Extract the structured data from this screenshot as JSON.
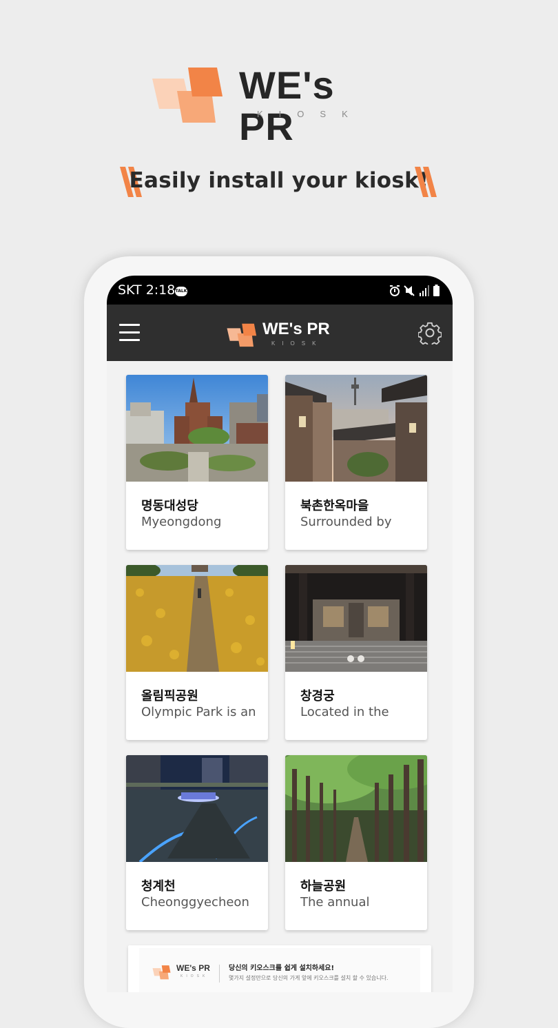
{
  "brand": {
    "title": "WE's PR",
    "subtitle": "KIOSK",
    "tagline": "Easily install your kiosk!",
    "accent_color": "#f28447",
    "accent_light": "#f9c2a0"
  },
  "status_bar": {
    "carrier_time": "SKT 2:18",
    "talk_badge": "TALK",
    "icons": [
      "alarm-icon",
      "mute-icon",
      "signal-icon",
      "battery-icon"
    ]
  },
  "app_bar": {
    "title": "WE's PR",
    "subtitle": "KIOSK",
    "menu_icon": "hamburger-menu-icon",
    "settings_icon": "gear-icon"
  },
  "places": [
    {
      "name": "명동대성당",
      "desc": "Myeongdong"
    },
    {
      "name": "북촌한옥마을",
      "desc": "Surrounded by"
    },
    {
      "name": "올림픽공원",
      "desc": "Olympic Park is an"
    },
    {
      "name": "창경궁",
      "desc": "Located in the"
    },
    {
      "name": "청계천",
      "desc": "Cheonggyecheon"
    },
    {
      "name": "하늘공원",
      "desc": "The annual"
    }
  ],
  "banner": {
    "title": "WE's PR",
    "subtitle": "KIOSK",
    "headline": "당신의 키오스크를 쉽게 설치하세요!",
    "body": "몇가지 설정만으로 당신의 가게 앞에 키오스크를 설치 할 수 있습니다."
  }
}
